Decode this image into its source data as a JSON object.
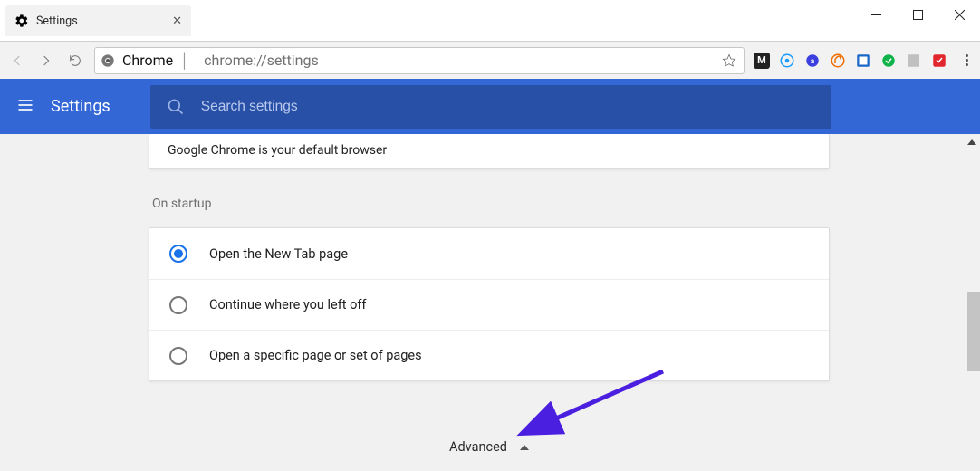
{
  "tab": {
    "title": "Settings"
  },
  "omnibox": {
    "origin_label": "Chrome",
    "url_text": "chrome://settings"
  },
  "settings_header": {
    "title": "Settings"
  },
  "search": {
    "placeholder": "Search settings"
  },
  "default_browser": {
    "text": "Google Chrome is your default browser"
  },
  "startup": {
    "label": "On startup",
    "options": {
      "new_tab": "Open the New Tab page",
      "continue": "Continue where you left off",
      "specific": "Open a specific page or set of pages"
    }
  },
  "advanced": {
    "label": "Advanced"
  }
}
